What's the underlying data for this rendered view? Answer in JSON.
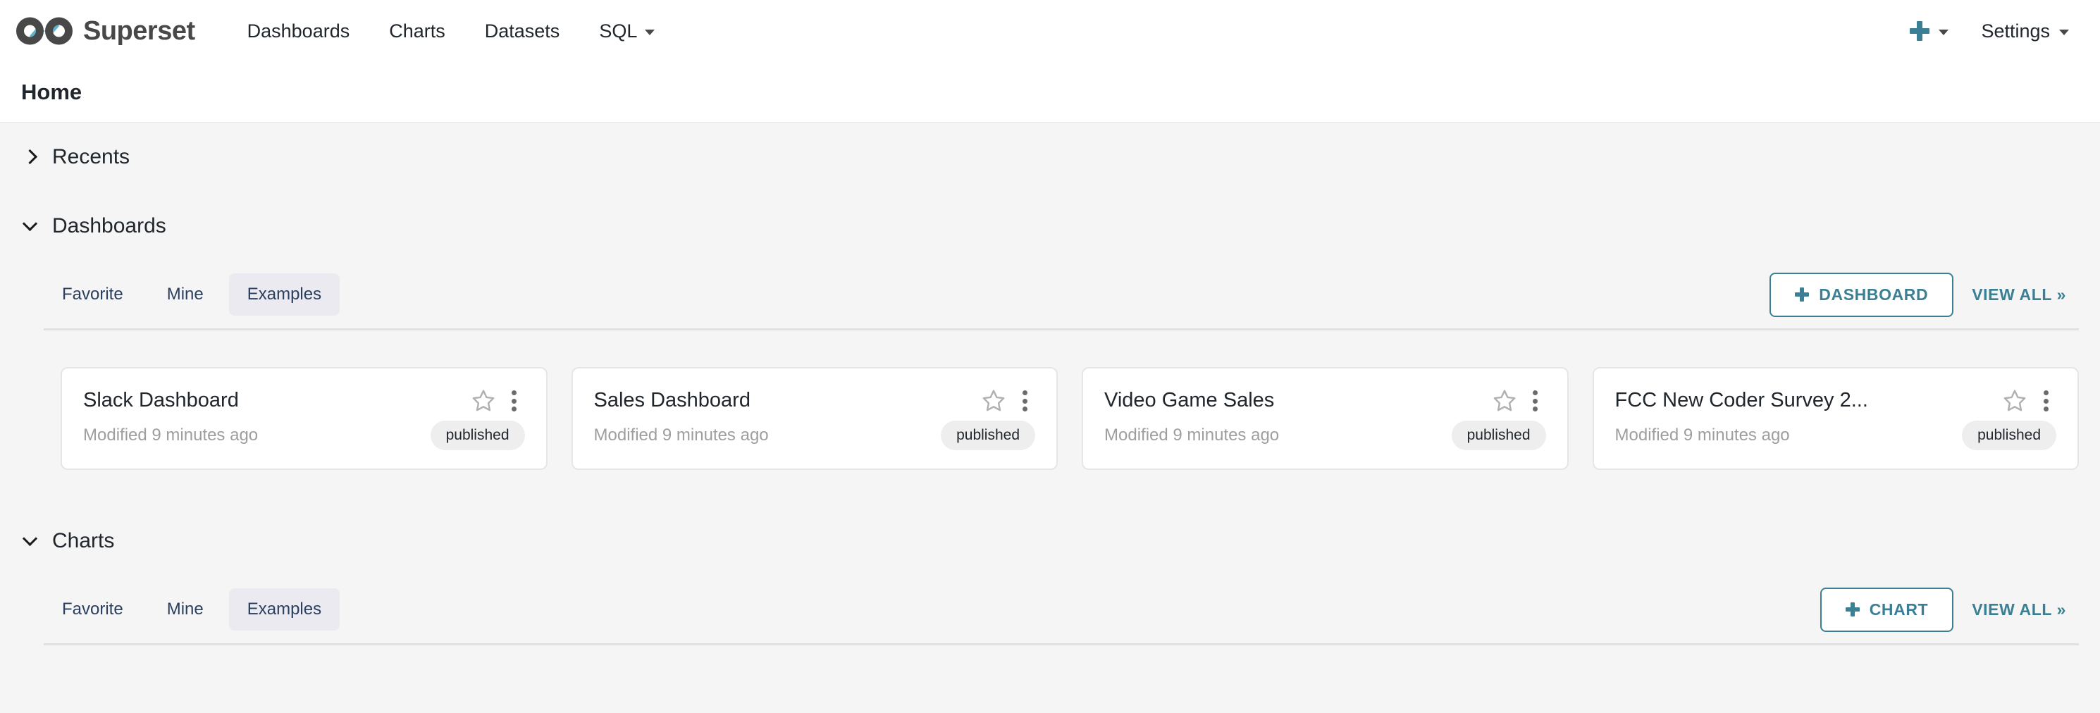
{
  "navbar": {
    "brand": "Superset",
    "brand_logo_icon": "superset-infinity-logo",
    "links": [
      {
        "label": "Dashboards",
        "has_caret": false
      },
      {
        "label": "Charts",
        "has_caret": false
      },
      {
        "label": "Datasets",
        "has_caret": false
      },
      {
        "label": "SQL",
        "has_caret": true
      }
    ],
    "plus_icon": "plus-icon",
    "settings_label": "Settings",
    "accent_color": "#3a7f93"
  },
  "page": {
    "title": "Home"
  },
  "sections": [
    {
      "key": "recents",
      "title": "Recents",
      "expanded": false,
      "chevron_icon": "chevron-right-icon"
    },
    {
      "key": "dashboards",
      "title": "Dashboards",
      "expanded": true,
      "chevron_icon": "chevron-down-icon",
      "tabs": [
        {
          "label": "Favorite",
          "active": false
        },
        {
          "label": "Mine",
          "active": false
        },
        {
          "label": "Examples",
          "active": true
        }
      ],
      "create_button": {
        "label": "DASHBOARD",
        "icon": "plus-icon"
      },
      "view_all": "VIEW ALL »",
      "cards": [
        {
          "title": "Slack Dashboard",
          "modified": "Modified 9 minutes ago",
          "badge": "published",
          "star_icon": "star-outline-icon",
          "menu_icon": "more-vertical-icon"
        },
        {
          "title": "Sales Dashboard",
          "modified": "Modified 9 minutes ago",
          "badge": "published",
          "star_icon": "star-outline-icon",
          "menu_icon": "more-vertical-icon"
        },
        {
          "title": "Video Game Sales",
          "modified": "Modified 9 minutes ago",
          "badge": "published",
          "star_icon": "star-outline-icon",
          "menu_icon": "more-vertical-icon"
        },
        {
          "title": "FCC New Coder Survey 2...",
          "modified": "Modified 9 minutes ago",
          "badge": "published",
          "star_icon": "star-outline-icon",
          "menu_icon": "more-vertical-icon"
        }
      ]
    },
    {
      "key": "charts",
      "title": "Charts",
      "expanded": true,
      "chevron_icon": "chevron-down-icon",
      "tabs": [
        {
          "label": "Favorite",
          "active": false
        },
        {
          "label": "Mine",
          "active": false
        },
        {
          "label": "Examples",
          "active": true
        }
      ],
      "create_button": {
        "label": "CHART",
        "icon": "plus-icon"
      },
      "view_all": "VIEW ALL »"
    }
  ]
}
